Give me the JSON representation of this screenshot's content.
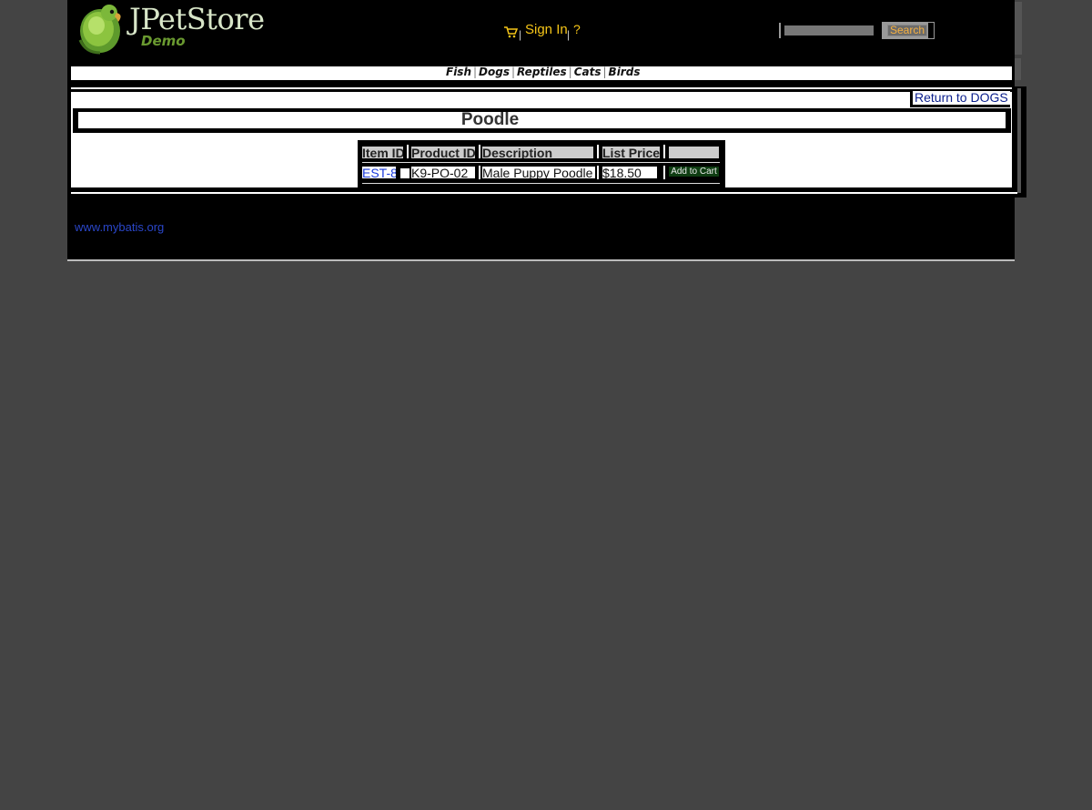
{
  "header": {
    "logo_title": "JPetStore",
    "logo_subtitle": "Demo",
    "signin_label": "Sign In",
    "help_label": "?",
    "separator": "|",
    "search": {
      "value": "",
      "button_label": "Search"
    }
  },
  "quicklinks": [
    {
      "label": "Fish"
    },
    {
      "label": "Dogs"
    },
    {
      "label": "Reptiles"
    },
    {
      "label": "Cats"
    },
    {
      "label": "Birds"
    }
  ],
  "content": {
    "return_link": "Return to DOGS",
    "title": "Poodle",
    "table": {
      "headers": [
        "Item ID",
        "Product ID",
        "Description",
        "List Price",
        ""
      ],
      "rows": [
        {
          "item_id": "EST-8",
          "product_id": "K9-PO-02",
          "description": "Male Puppy Poodle",
          "list_price": "$18.50",
          "action": "Add to Cart"
        }
      ]
    }
  },
  "footer": {
    "link": "www.mybatis.org"
  },
  "colors": {
    "page_bg": "#444444",
    "accent_link": "#f5c518",
    "cart_button": "#0e3d12"
  }
}
